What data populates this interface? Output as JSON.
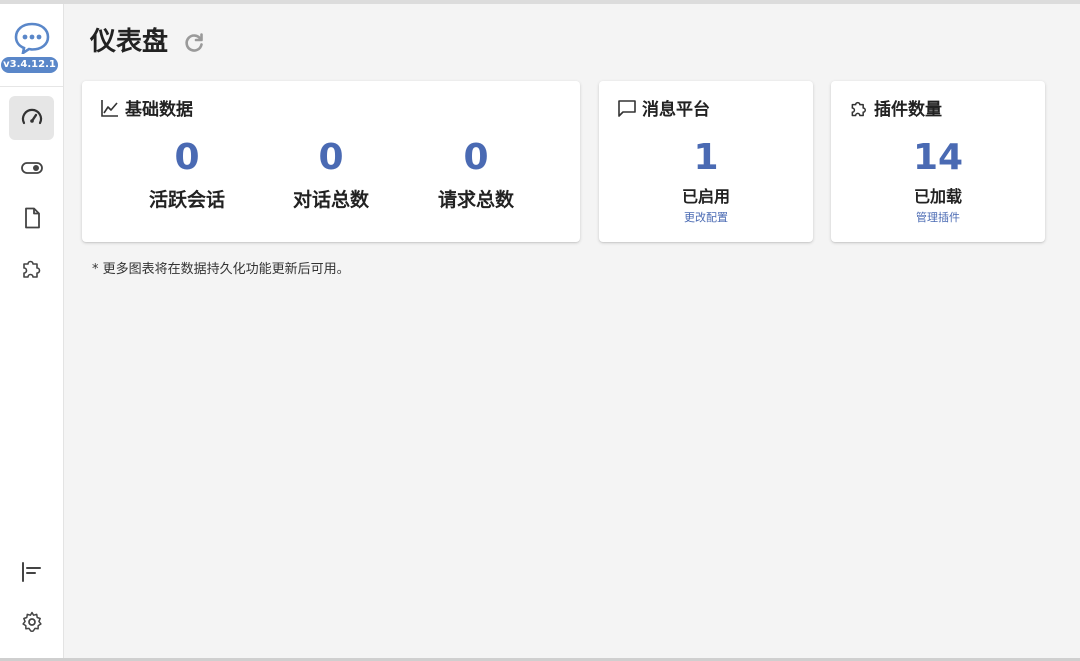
{
  "app": {
    "version": "v3.4.12.1"
  },
  "page": {
    "title": "仪表盘"
  },
  "cards": {
    "basic": {
      "title": "基础数据",
      "stats": [
        {
          "value": "0",
          "label": "活跃会话"
        },
        {
          "value": "0",
          "label": "对话总数"
        },
        {
          "value": "0",
          "label": "请求总数"
        }
      ]
    },
    "platform": {
      "title": "消息平台",
      "value": "1",
      "label": "已启用",
      "link": "更改配置"
    },
    "plugins": {
      "title": "插件数量",
      "value": "14",
      "label": "已加载",
      "link": "管理插件"
    }
  },
  "note": "* 更多图表将在数据持久化功能更新后可用。",
  "icons": {
    "logo": "chat-bubble-logo-icon",
    "nav": [
      "dashboard-gauge-icon",
      "toggle-switch-icon",
      "file-icon",
      "puzzle-icon"
    ],
    "bottom_nav": [
      "align-left-icon",
      "gear-icon"
    ],
    "refresh": "refresh-icon"
  },
  "colors": {
    "accent": "#4a6ab3",
    "version_badge": "#5a87c9"
  }
}
